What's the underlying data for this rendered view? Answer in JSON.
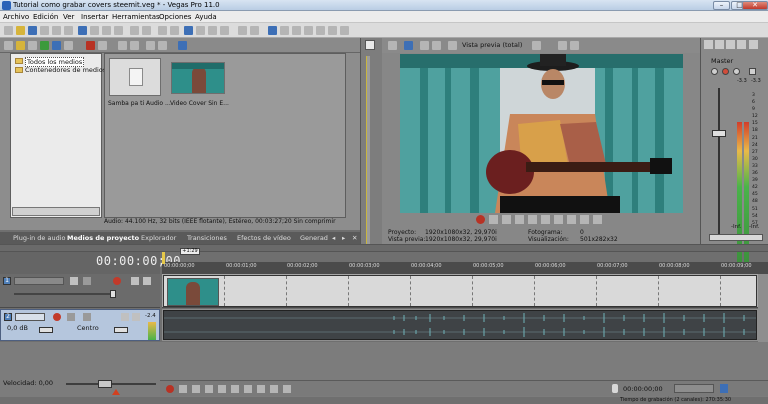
{
  "window": {
    "title": "Tutorial como grabar covers steemit.veg * - Vegas Pro 11.0"
  },
  "menu": [
    "Archivo",
    "Edición",
    "Ver",
    "Insertar",
    "Herramientas",
    "Opciones",
    "Ayuda"
  ],
  "explorer": {
    "tree": [
      "Todos los medios",
      "Contenedores de medios"
    ],
    "media": [
      {
        "name": "Samba pa ti Audio ...",
        "kind": "audio"
      },
      {
        "name": "Video Cover Sin E...",
        "kind": "video"
      }
    ],
    "info": "Audio: 44.100 Hz, 32 bits (IEEE flotante), Estéreo, 00:03:27;20  Sin comprimir"
  },
  "tabs": [
    "Plug-in de audio",
    "Medios de proyecto",
    "Explorador",
    "Transiciones",
    "Efectos de vídeo",
    "Generad"
  ],
  "active_tab": "Medios de proyecto",
  "preview": {
    "mode": "Vista previa (total)",
    "proyecto_label": "Proyecto:",
    "proyecto": "1920x1080x32, 29,970i",
    "vista_previa_label": "Vista previa:",
    "vista_previa": "1920x1080x32, 29,970i",
    "fotograma_label": "Fotograma:",
    "fotograma": "0",
    "visualizacion_label": "Visualización:",
    "visualizacion": "501x282x32"
  },
  "mixer": {
    "title": "Master",
    "scale": [
      "-3.3",
      "-3.3",
      "3",
      "6",
      "9",
      "12",
      "15",
      "18",
      "21",
      "24",
      "27",
      "30",
      "33",
      "36",
      "39",
      "42",
      "45",
      "48",
      "51",
      "54",
      "57"
    ],
    "bottom_values": [
      "-Inf.",
      "-Inf."
    ]
  },
  "timeline": {
    "timecode": "00:00:00;00",
    "ruler": [
      "00:00:00;00",
      "00:00:01;00",
      "00:00:02;00",
      "00:00:03;00",
      "00:00:04;00",
      "00:00:05;00",
      "00:00:06;00",
      "00:00:07;00",
      "00:00:08;00",
      "00:00:09;00"
    ],
    "marker": "+1:29",
    "tracks": [
      {
        "index": "1",
        "type": "video"
      },
      {
        "index": "2",
        "type": "audio",
        "volume": "0,0 dB",
        "pan": "Centro",
        "meter": "-2.4"
      }
    ]
  },
  "bottom": {
    "velocidad": "Velocidad: 0,00",
    "transport_time": "00:00:00;00",
    "status": "Tiempo de grabación (2 canales): 270:35:30"
  }
}
